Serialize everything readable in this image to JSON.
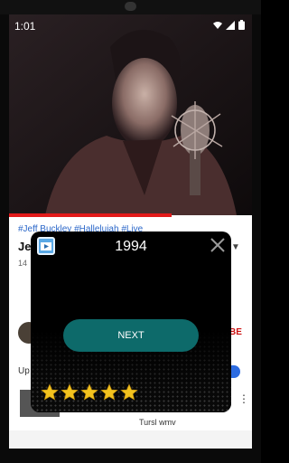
{
  "status_bar": {
    "time": "1:01"
  },
  "background_page": {
    "hashtags": "#Jeff Buckley #Hallelujah #Live",
    "title_fragment": "Je",
    "meta_fragment": "14",
    "subscribe_fragment": "BE",
    "upnext_fragment": "Up",
    "description_fragment": "Tursl wmv"
  },
  "dialog": {
    "year": "1994",
    "next_label": "NEXT",
    "rating": 5,
    "max_rating": 5
  },
  "colors": {
    "accent_red": "#e21a1a",
    "next_button": "#0d6a6a",
    "star_gold": "#f2c21e",
    "link_blue": "#2b67c9"
  }
}
